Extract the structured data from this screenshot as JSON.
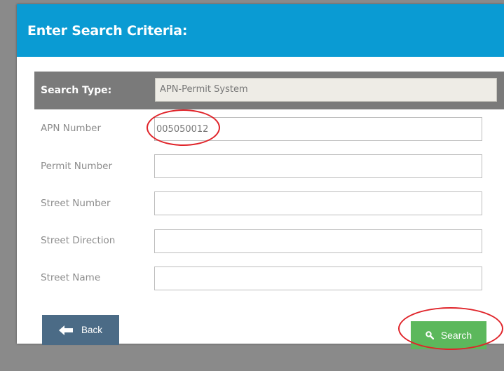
{
  "header": {
    "title": "Enter Search Criteria:"
  },
  "search_type": {
    "label": "Search Type:",
    "value": "APN-Permit System"
  },
  "fields": [
    {
      "label": "APN Number",
      "value": "005050012"
    },
    {
      "label": "Permit Number",
      "value": ""
    },
    {
      "label": "Street Number",
      "value": ""
    },
    {
      "label": "Street Direction",
      "value": ""
    },
    {
      "label": "Street Name",
      "value": ""
    }
  ],
  "buttons": {
    "back_label": "Back",
    "search_label": "Search"
  },
  "icons": {
    "back": "arrow-left-icon",
    "search": "magnifier-icon"
  },
  "colors": {
    "header": "#0a9bd3",
    "back_button": "#4b6b86",
    "search_button": "#5cb85c",
    "annotation": "#e0242a"
  }
}
